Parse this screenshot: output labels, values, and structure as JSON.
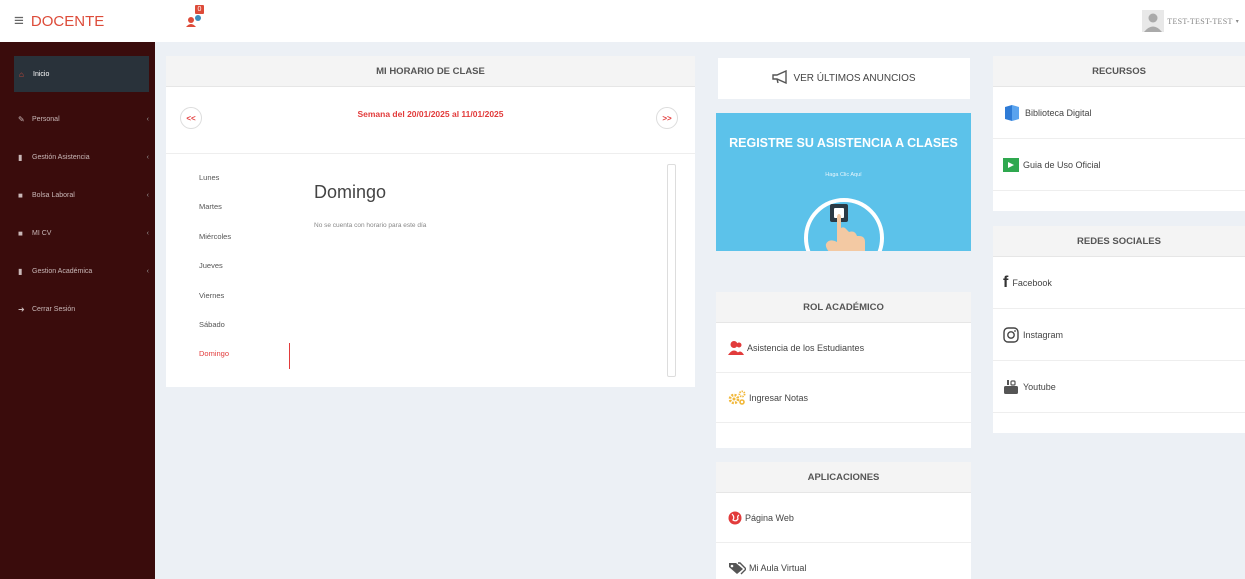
{
  "app": {
    "brand": "DOCENTE",
    "notification_count": "0",
    "user_name": "TEST-TEST-TEST"
  },
  "sidebar": {
    "items": [
      {
        "label": "Inicio",
        "icon": "home-icon",
        "active": true
      },
      {
        "label": "Personal",
        "icon": "edit-icon"
      },
      {
        "label": "Gestión Asistencia",
        "icon": "bookmark-icon"
      },
      {
        "label": "Bolsa Laboral",
        "icon": "briefcase-icon"
      },
      {
        "label": "MI CV",
        "icon": "briefcase-icon"
      },
      {
        "label": "Gestion Académica",
        "icon": "bookmark-icon"
      },
      {
        "label": "Cerrar Sesión",
        "icon": "sign-out-icon"
      }
    ]
  },
  "horario": {
    "title": "MI HORARIO DE CLASE",
    "prev_label": "<<",
    "next_label": ">>",
    "week_label": "Semana del 20/01/2025 al 11/01/2025",
    "days": [
      "Lunes",
      "Martes",
      "Miércoles",
      "Jueves",
      "Viernes",
      "Sábado",
      "Domingo"
    ],
    "selected_day": "Domingo",
    "empty_message": "No se cuenta con horario para este día"
  },
  "anuncios": {
    "label": "VER ÚLTIMOS ANUNCIOS"
  },
  "banner": {
    "title": "REGISTRE SU ASISTENCIA A CLASES",
    "subtitle": "Haga Clic Aquí"
  },
  "rol": {
    "title": "ROL ACADÉMICO",
    "items": [
      "Asistencia de los Estudiantes",
      "Ingresar Notas"
    ]
  },
  "aplicaciones": {
    "title": "APLICACIONES",
    "items": [
      "Página Web",
      "Mi Aula Virtual"
    ]
  },
  "recursos": {
    "title": "RECURSOS",
    "items": [
      "Biblioteca Digital",
      "Guia de Uso Oficial"
    ]
  },
  "redes": {
    "title": "REDES SOCIALES",
    "items": [
      "Facebook",
      "Instagram",
      "Youtube"
    ]
  },
  "colors": {
    "accent": "#dd4b39",
    "sidebar": "#3a0c0c",
    "banner": "#5cc2ea"
  }
}
